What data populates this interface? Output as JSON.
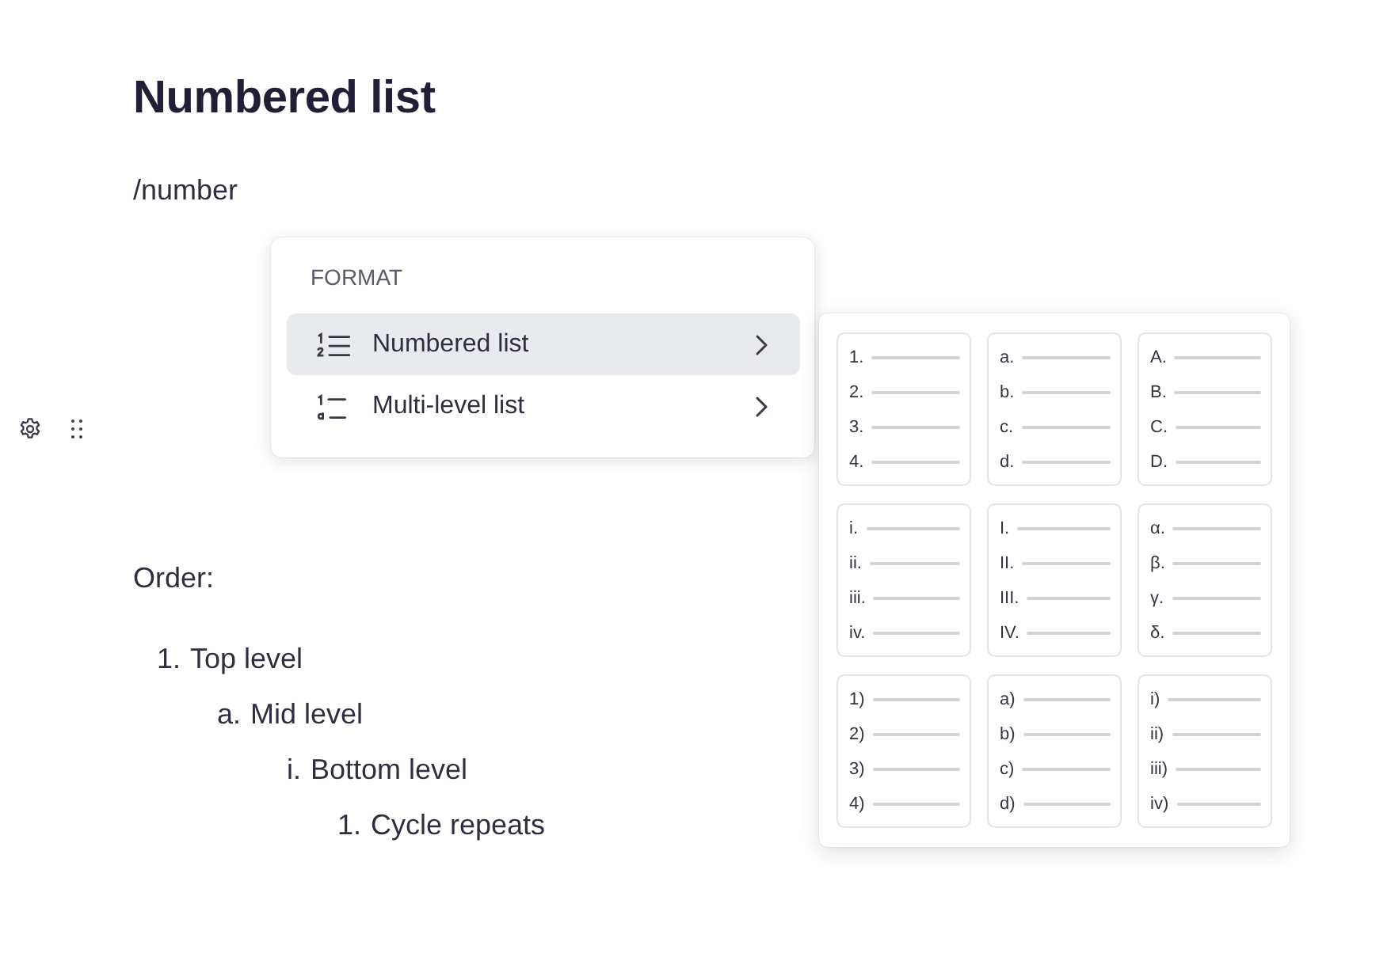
{
  "heading": "Numbered list",
  "command": "/number",
  "menu": {
    "section": "FORMAT",
    "items": [
      {
        "kind": "numbered",
        "label": "Numbered list",
        "selected": true
      },
      {
        "kind": "multilevel",
        "label": "Multi-level list",
        "selected": false
      }
    ]
  },
  "styles": [
    {
      "markers": [
        "1.",
        "2.",
        "3.",
        "4."
      ]
    },
    {
      "markers": [
        "a.",
        "b.",
        "c.",
        "d."
      ]
    },
    {
      "markers": [
        "A.",
        "B.",
        "C.",
        "D."
      ]
    },
    {
      "markers": [
        "i.",
        "ii.",
        "iii.",
        "iv."
      ]
    },
    {
      "markers": [
        "I.",
        "II.",
        "III.",
        "IV."
      ]
    },
    {
      "markers": [
        "α.",
        "β.",
        "γ.",
        "δ."
      ]
    },
    {
      "markers": [
        "1)",
        "2)",
        "3)",
        "4)"
      ]
    },
    {
      "markers": [
        "a)",
        "b)",
        "c)",
        "d)"
      ]
    },
    {
      "markers": [
        "i)",
        "ii)",
        "iii)",
        "iv)"
      ]
    }
  ],
  "content": {
    "label": "Order:",
    "list": [
      {
        "marker": "1.",
        "text": "Top level",
        "children": [
          {
            "marker": "a.",
            "text": "Mid level",
            "children": [
              {
                "marker": "i.",
                "text": "Bottom level",
                "children": [
                  {
                    "marker": "1.",
                    "text": "Cycle repeats"
                  }
                ]
              }
            ]
          }
        ]
      }
    ]
  }
}
